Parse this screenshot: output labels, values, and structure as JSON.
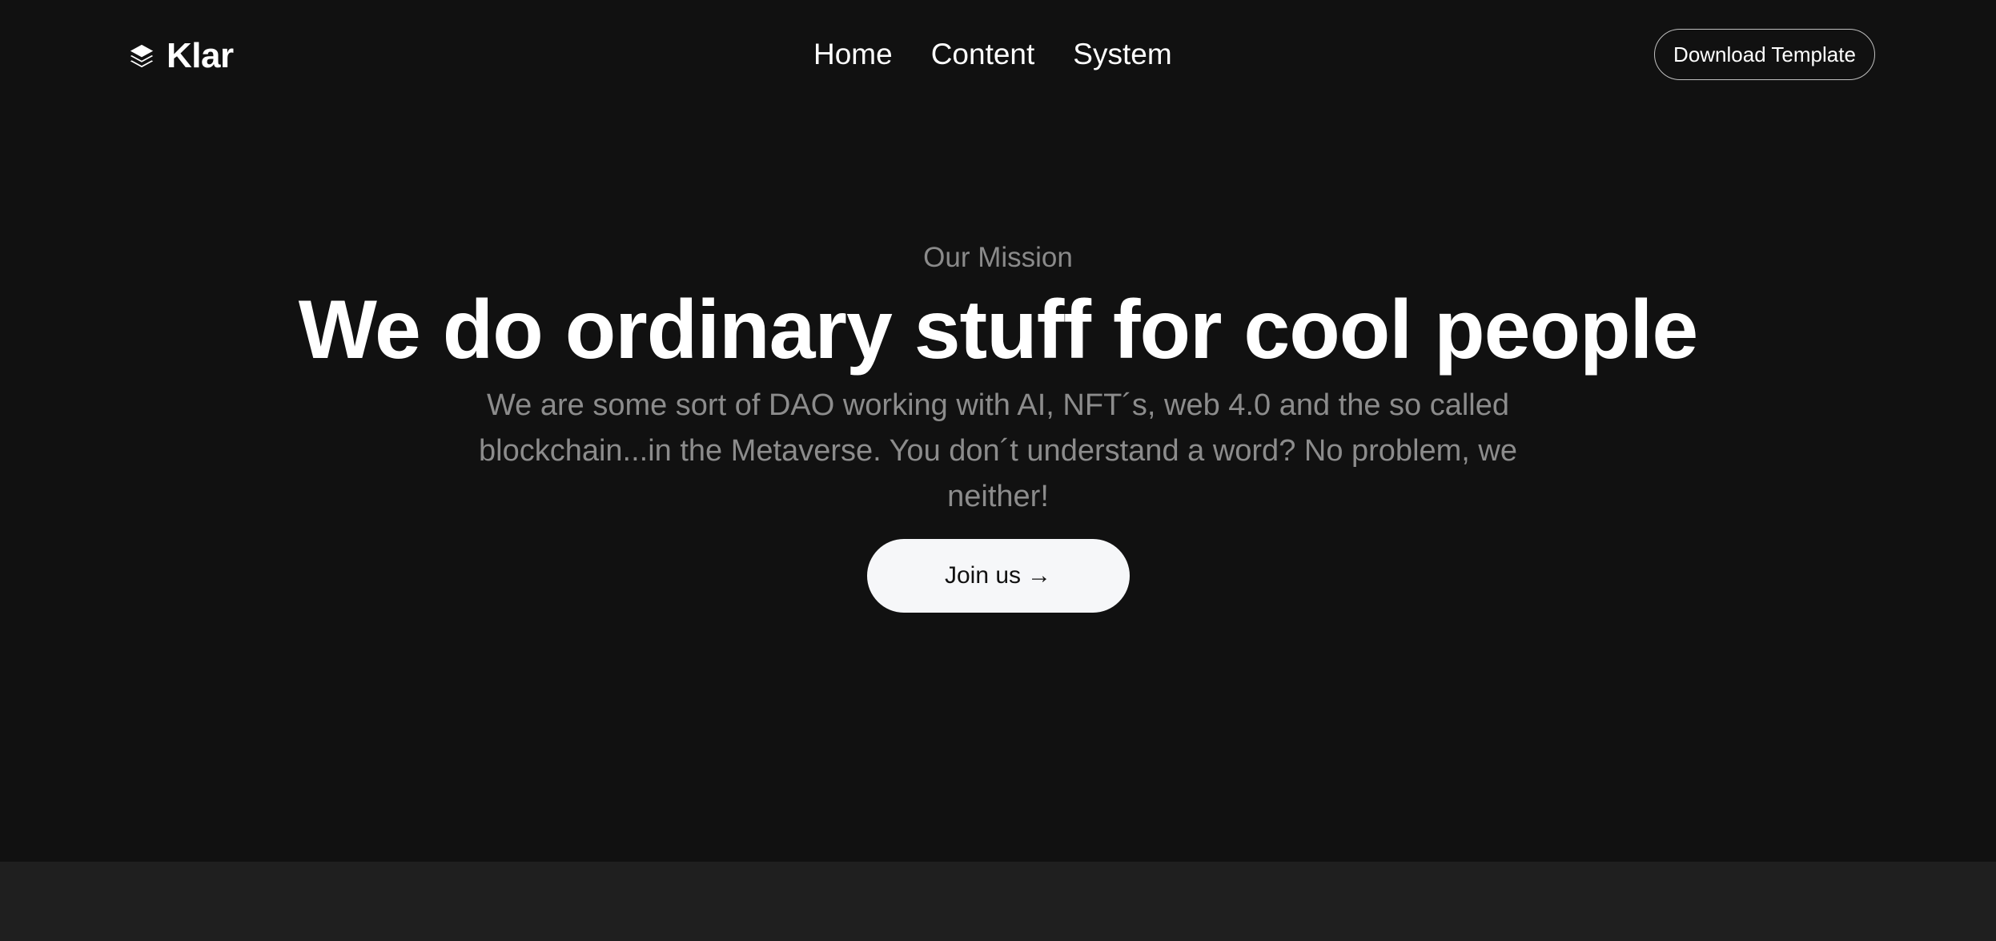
{
  "header": {
    "brand": {
      "icon": "layers-icon",
      "name": "Klar"
    },
    "nav": [
      {
        "label": "Home"
      },
      {
        "label": "Content"
      },
      {
        "label": "System"
      }
    ],
    "download_label": "Download Template"
  },
  "hero": {
    "eyebrow": "Our Mission",
    "headline": "We do ordinary stuff for cool people",
    "subtitle": "We are some sort of DAO working with AI, NFT´s, web 4.0 and the so called blockchain...in the Metaverse. You don´t understand a word? No problem, we neither!",
    "cta_label": "Join us",
    "cta_arrow": "→"
  },
  "colors": {
    "background": "#111111",
    "bottom_band": "#1f1f1f",
    "cta_background": "#f6f7f9",
    "muted_text": "#8a8a8a",
    "text": "#ffffff"
  }
}
